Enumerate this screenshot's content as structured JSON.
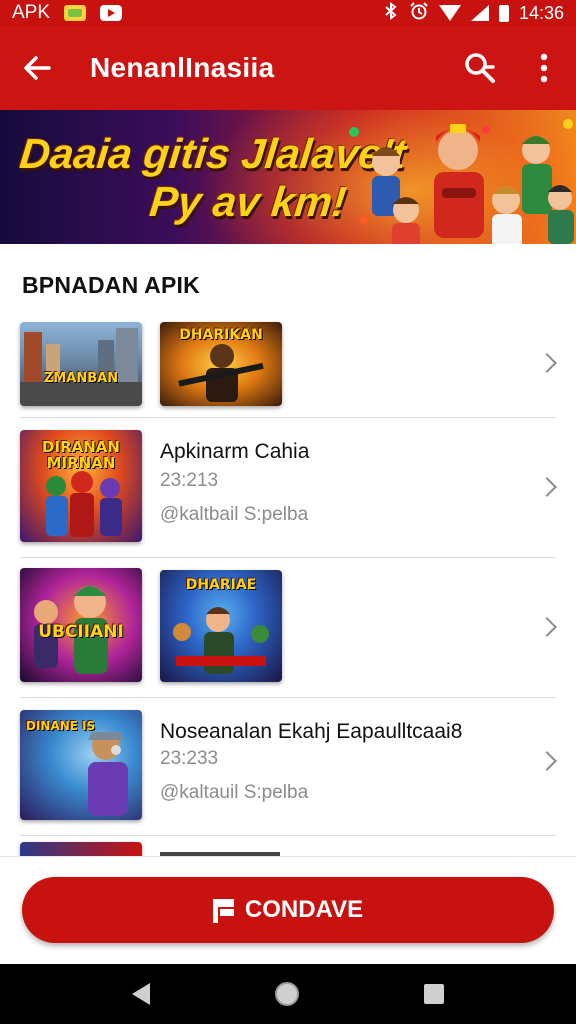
{
  "status_bar": {
    "app_label": "APK",
    "time": "14:36",
    "icons": [
      "notification-icon",
      "youtube-icon",
      "bluetooth-icon",
      "alarm-icon",
      "wifi-icon",
      "signal-icon",
      "battery-icon"
    ]
  },
  "app_bar": {
    "title": "NenanlInasiia",
    "icons": [
      "back-arrow-icon",
      "search-icon",
      "more-vertical-icon"
    ]
  },
  "banner": {
    "line1": "Daaia gitis Jlalave't",
    "line2": "Py av km!"
  },
  "section": {
    "title": "BPNADAN APIK"
  },
  "list": [
    {
      "thumbs": [
        {
          "label": "ZMANBAN",
          "colors": [
            "#5d7fa8",
            "#9aa7b0",
            "#3a3f4a"
          ]
        },
        {
          "label": "DHARIKAN",
          "colors": [
            "#f4a11b",
            "#b9510e",
            "#2a1608"
          ]
        }
      ]
    },
    {
      "thumbs": [
        {
          "label": "DIRANAN MIRNAN",
          "colors": [
            "#ff8a1f",
            "#d0281c",
            "#3d1770"
          ]
        }
      ],
      "title": "Apkinarm Cahia",
      "code": "23:213",
      "meta": "@kaltbail S:pelba"
    },
    {
      "thumbs": [
        {
          "label": "UBCIIANI",
          "colors": [
            "#ff7a18",
            "#7a1aa8",
            "#140a2a"
          ]
        },
        {
          "label": "DHARIAE",
          "colors": [
            "#2d66c8",
            "#6a36b8",
            "#1a1546"
          ]
        }
      ]
    },
    {
      "thumbs": [
        {
          "label": "DINANE IS",
          "colors": [
            "#3a8ad0",
            "#8a3ad0",
            "#1a1a3a"
          ]
        }
      ],
      "title": "Noseanalan Ekahj Eapaulltcaai8",
      "code": "23:233",
      "meta": "@kaltauil S:pelba"
    }
  ],
  "action": {
    "button_label": "CONDAVE",
    "icon": "flag-icon"
  },
  "nav_bar": {
    "icons": [
      "nav-back-icon",
      "nav-home-icon",
      "nav-recents-icon"
    ]
  },
  "colors": {
    "primary": "#cc1512",
    "status_bar": "#c8120f",
    "banner_text": "#ffd21a",
    "meta_text": "#8c8c8c"
  }
}
